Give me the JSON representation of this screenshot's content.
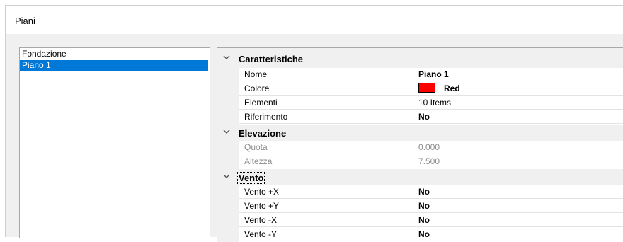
{
  "window": {
    "title": "Piani"
  },
  "floors": [
    {
      "label": "Fondazione",
      "selected": false
    },
    {
      "label": "Piano 1",
      "selected": true
    }
  ],
  "properties": {
    "caratteristiche": {
      "label": "Caratteristiche",
      "nome": {
        "name": "Nome",
        "value": "Piano 1"
      },
      "colore": {
        "name": "Colore",
        "value": "Red",
        "swatch": "#ff0000"
      },
      "elementi": {
        "name": "Elementi",
        "value": "10 Items"
      },
      "riferimento": {
        "name": "Riferimento",
        "value": "No"
      }
    },
    "elevazione": {
      "label": "Elevazione",
      "quota": {
        "name": "Quota",
        "value": "0.000"
      },
      "altezza": {
        "name": "Altezza",
        "value": "7.500"
      }
    },
    "vento": {
      "label": "Vento",
      "x_pos": {
        "name": "Vento +X",
        "value": "No"
      },
      "y_pos": {
        "name": "Vento +Y",
        "value": "No"
      },
      "x_neg": {
        "name": "Vento -X",
        "value": "No"
      },
      "y_neg": {
        "name": "Vento -Y",
        "value": "No"
      }
    }
  },
  "colors": {
    "selection": "#0078d7",
    "disabled_text": "#8c8c8c"
  }
}
